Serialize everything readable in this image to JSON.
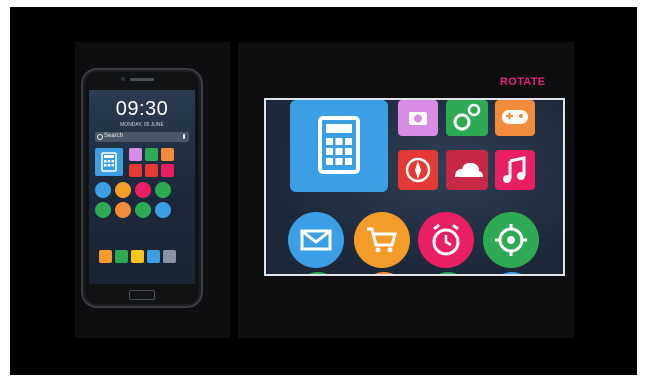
{
  "phone": {
    "time": "09:30",
    "date": "MONDAY, 05 JUNE",
    "search_label": "Search",
    "home_page_dots": 5,
    "active_dot": 2
  },
  "zoom_view": {
    "label": "ROTATE"
  },
  "colors": {
    "accent": "#e6207a",
    "blue": "#3b9fe6",
    "orange": "#f39c2a",
    "green": "#2eaa55",
    "red": "#e53935",
    "pink": "#e91e63",
    "lavender": "#d98ce6"
  },
  "icons": [
    "calculator-icon",
    "camera-icon",
    "settings-gears-icon",
    "gamepad-icon",
    "compass-icon",
    "cloud-icon",
    "music-note-icon",
    "mail-icon",
    "shopping-cart-icon",
    "alarm-clock-icon",
    "location-target-icon"
  ]
}
